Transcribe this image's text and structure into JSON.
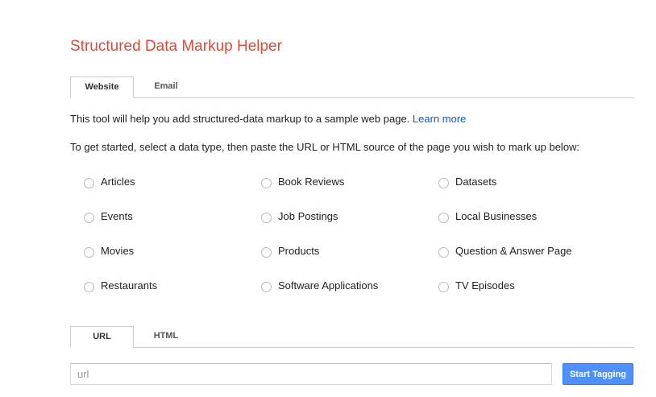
{
  "title": "Structured Data Markup Helper",
  "top_tabs": [
    {
      "label": "Website",
      "active": true
    },
    {
      "label": "Email",
      "active": false
    }
  ],
  "intro": {
    "text": "This tool will help you add structured-data markup to a sample web page. ",
    "link": "Learn more"
  },
  "instructions": "To get started, select a data type, then paste the URL or HTML source of the page you wish to mark up below:",
  "data_types": [
    {
      "label": "Articles"
    },
    {
      "label": "Book Reviews"
    },
    {
      "label": "Datasets"
    },
    {
      "label": "Events"
    },
    {
      "label": "Job Postings"
    },
    {
      "label": "Local Businesses"
    },
    {
      "label": "Movies"
    },
    {
      "label": "Products"
    },
    {
      "label": "Question & Answer Page"
    },
    {
      "label": "Restaurants"
    },
    {
      "label": "Software Applications"
    },
    {
      "label": "TV Episodes"
    }
  ],
  "source_tabs": [
    {
      "label": "URL",
      "active": true
    },
    {
      "label": "HTML",
      "active": false
    }
  ],
  "url_input": {
    "value": "",
    "placeholder": "url"
  },
  "start_button": {
    "label": "Start Tagging"
  },
  "colors": {
    "title": "#dd4b39",
    "link": "#1155cc",
    "button": "#4d90fe"
  }
}
